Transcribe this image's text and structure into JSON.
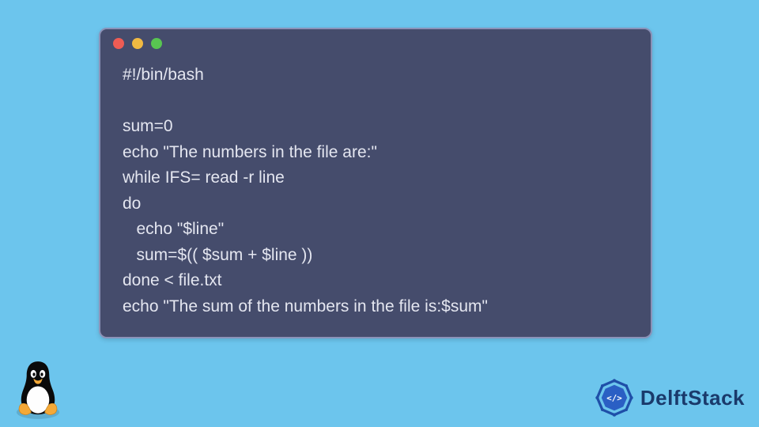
{
  "code": {
    "lines": [
      "#!/bin/bash",
      "",
      "sum=0",
      "echo \"The numbers in the file are:\"",
      "while IFS= read -r line",
      "do",
      "   echo \"$line\"",
      "   sum=$(( $sum + $line ))",
      "done < file.txt",
      "echo \"The sum of the numbers in the file is:$sum\""
    ]
  },
  "brand": {
    "name": "DelftStack"
  },
  "colors": {
    "bg": "#6cc5ed",
    "window": "#454c6c",
    "text": "#e4e6f0",
    "brand": "#1a3a6b"
  }
}
